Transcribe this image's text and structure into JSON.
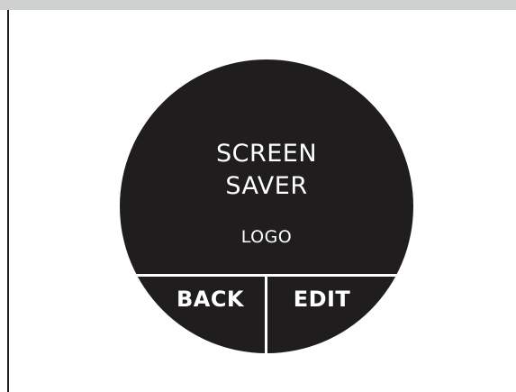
{
  "screen": {
    "title_line1": "SCREEN",
    "title_line2": "SAVER",
    "logo_text": "LOGO"
  },
  "buttons": {
    "back_label": "BACK",
    "edit_label": "EDIT"
  },
  "colors": {
    "device_face": "#1f1d1e",
    "text": "#ffffff",
    "top_bar": "#cfd1d0"
  }
}
